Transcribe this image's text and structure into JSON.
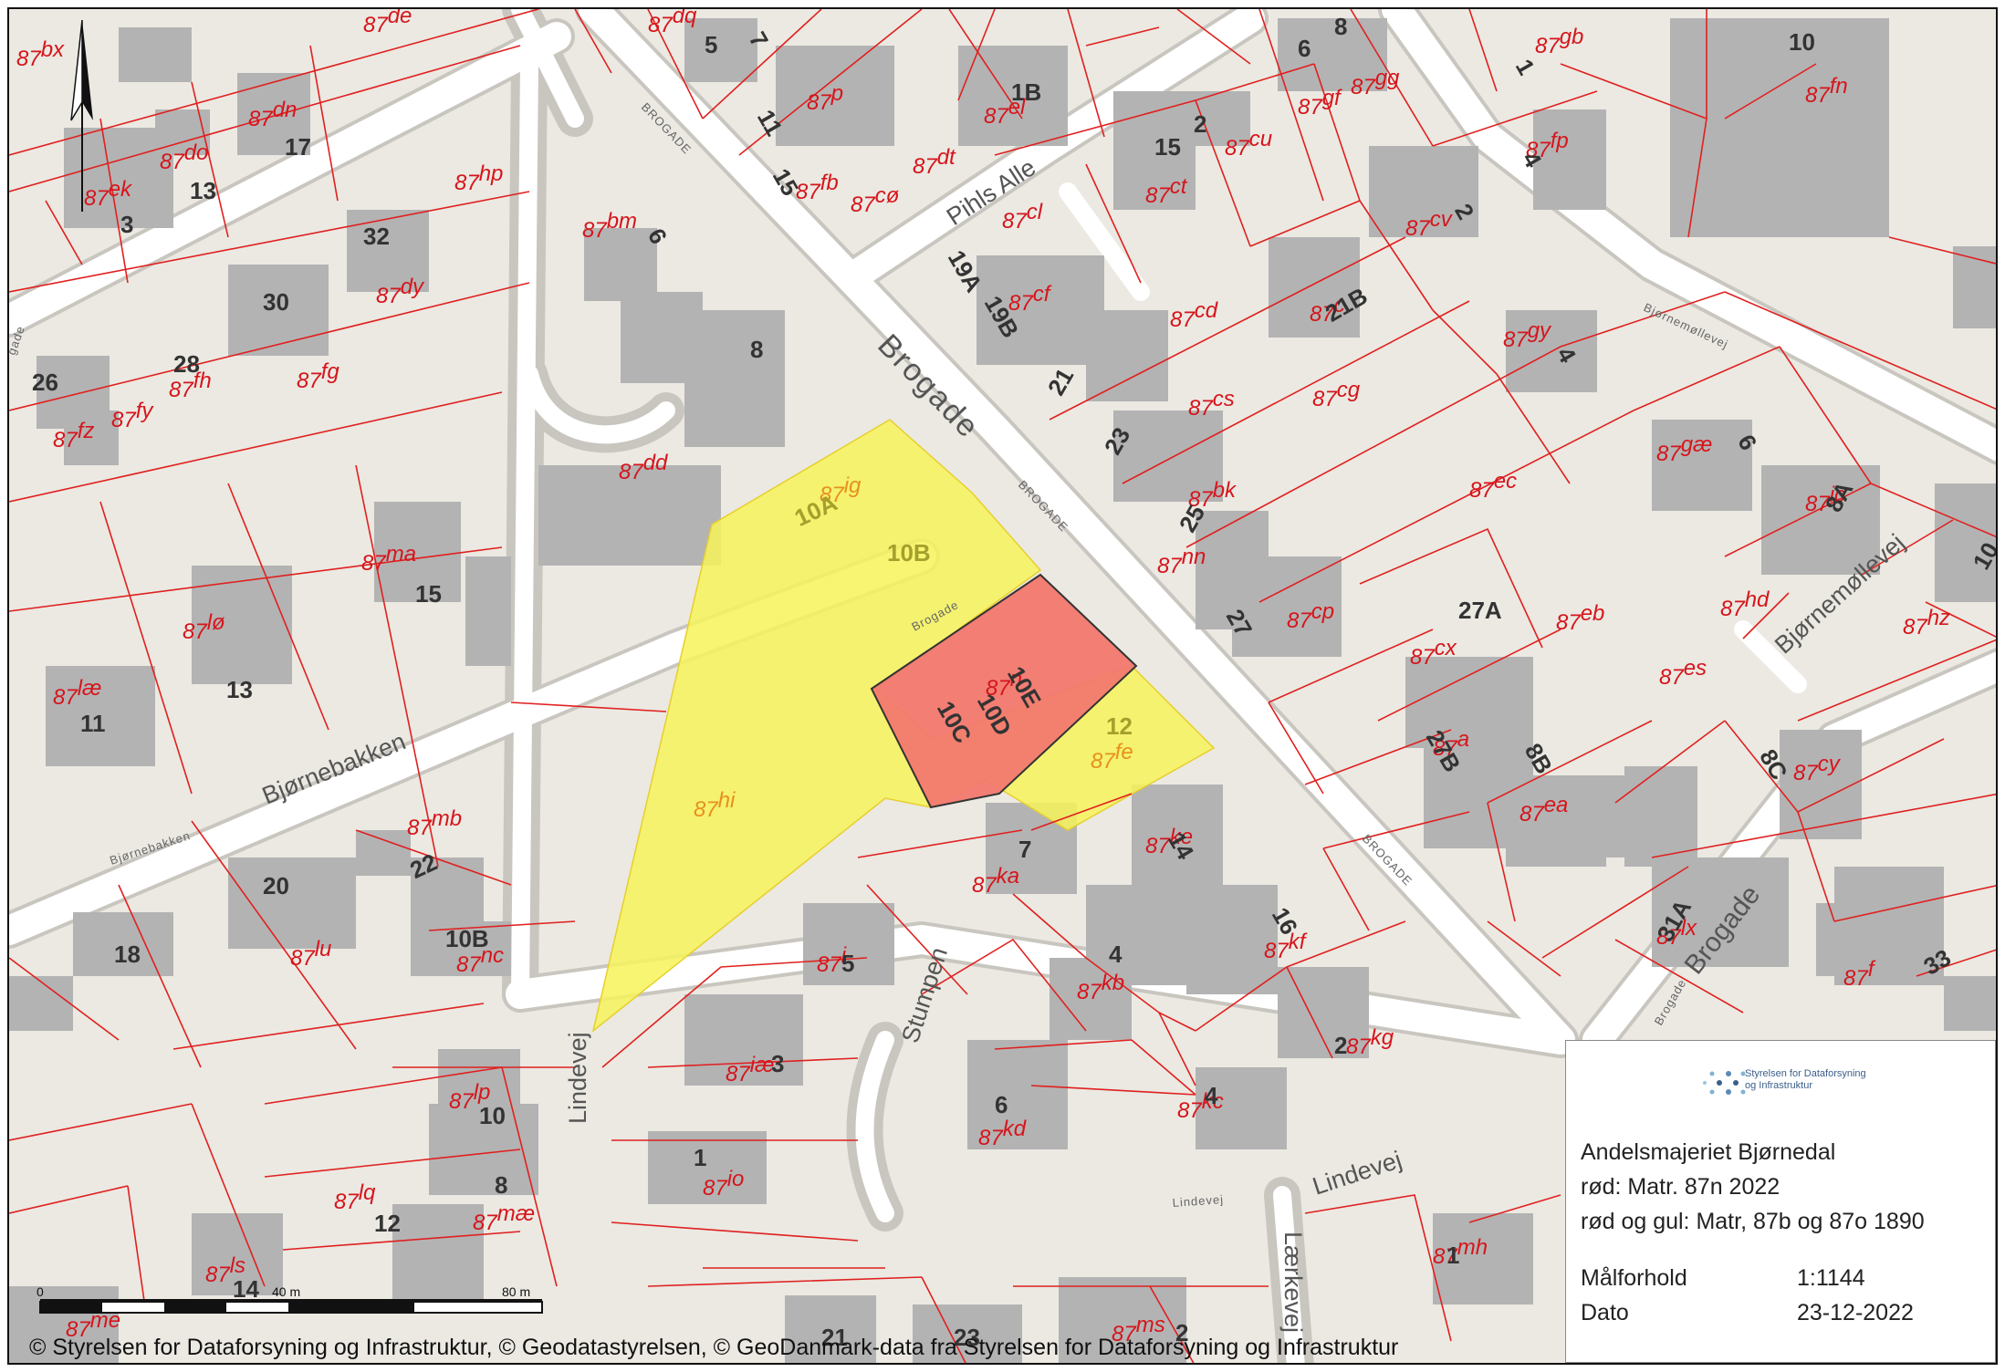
{
  "legend": {
    "agency": "Styrelsen for Dataforsyning og Infrastruktur",
    "title": "Andelsmajeriet Bjørnedal",
    "line_red": "rød: Matr. 87n 2022",
    "line_red_yellow": "rød og gul: Matr, 87b og 87o 1890",
    "scale_label": "Målforhold",
    "scale_value": "1:1144",
    "date_label": "Dato",
    "date_value": "23-12-2022"
  },
  "copyright": "© Styrelsen for Dataforsyning og Infrastruktur, © Geodatastyrelsen, © GeoDanmark-data fra Styrelsen for Dataforsyning og Infrastruktur",
  "scale_bar": {
    "labels": [
      "0",
      "40 m",
      "80 m"
    ]
  },
  "colors": {
    "highlight_red": "#f2786e",
    "highlight_yellow": "#f7f35a",
    "parcel_line": "#e0201f",
    "building": "#b3b3b3",
    "background": "#ebe9e2"
  },
  "streets": {
    "brogade_main": "Brogade",
    "brogade_lower": "Brogade",
    "pihls_alle": "Pihls Alle",
    "bjornemollevej_1": "Bjørnemøllevej",
    "bjornemollevej_2": "Bjørnemøllevej",
    "bjornebakken_1": "Bjørnebakken",
    "bjornebakken_2": "Bjørnebakken",
    "stumpen": "Stumpen",
    "lindevej_1": "Lindevej",
    "lindevej_2": "Lindevej",
    "lindevej_3": "Lindevej",
    "laerkevej": "Lærkevej",
    "brogade_small_1": "BROGADE",
    "brogade_small_2": "BROGADE",
    "brogade_small_3": "BROGADE",
    "brogade_small_4": "Brogade",
    "brogade_small_5": "Brogade",
    "lindevej_small": "Lindevej",
    "bjornemollevej_small": "Bjørnemøllevej",
    "bjornebakken_small": "Bjørnebakken",
    "road_left": "gade"
  },
  "plots": [
    {
      "num": "87",
      "sup": "bx"
    },
    {
      "num": "87",
      "sup": "de"
    },
    {
      "num": "87",
      "sup": "dq"
    },
    {
      "num": "87",
      "sup": "p"
    },
    {
      "num": "87",
      "sup": "el"
    },
    {
      "num": "87",
      "sup": "gf"
    },
    {
      "num": "87",
      "sup": "gg"
    },
    {
      "num": "87",
      "sup": "gb"
    },
    {
      "num": "87",
      "sup": "fn"
    },
    {
      "num": "87",
      "sup": "dn"
    },
    {
      "num": "87",
      "sup": "do"
    },
    {
      "num": "87",
      "sup": "ek"
    },
    {
      "num": "87",
      "sup": "hp"
    },
    {
      "num": "87",
      "sup": "bm"
    },
    {
      "num": "87",
      "sup": "fb"
    },
    {
      "num": "87",
      "sup": "cø"
    },
    {
      "num": "87",
      "sup": "dt"
    },
    {
      "num": "87",
      "sup": "cu"
    },
    {
      "num": "87",
      "sup": "ct"
    },
    {
      "num": "87",
      "sup": "fp"
    },
    {
      "num": "87",
      "sup": "cl"
    },
    {
      "num": "87",
      "sup": "cv"
    },
    {
      "num": "87",
      "sup": "dy"
    },
    {
      "num": "87",
      "sup": "cf"
    },
    {
      "num": "87",
      "sup": "cd"
    },
    {
      "num": "87",
      "sup": "c"
    },
    {
      "num": "87",
      "sup": "gy"
    },
    {
      "num": "87",
      "sup": "fh"
    },
    {
      "num": "87",
      "sup": "fg"
    },
    {
      "num": "87",
      "sup": "fy"
    },
    {
      "num": "87",
      "sup": "fz"
    },
    {
      "num": "87",
      "sup": "cs"
    },
    {
      "num": "87",
      "sup": "cg"
    },
    {
      "num": "87",
      "sup": "dd"
    },
    {
      "num": "87",
      "sup": "gæ"
    },
    {
      "num": "87",
      "sup": "ig"
    },
    {
      "num": "87",
      "sup": "bk"
    },
    {
      "num": "87",
      "sup": "ec"
    },
    {
      "num": "87",
      "sup": "ic"
    },
    {
      "num": "87",
      "sup": "ma"
    },
    {
      "num": "87",
      "sup": "nn"
    },
    {
      "num": "87",
      "sup": "lø"
    },
    {
      "num": "87",
      "sup": "cp"
    },
    {
      "num": "87",
      "sup": "hd"
    },
    {
      "num": "87",
      "sup": "eb"
    },
    {
      "num": "87",
      "sup": "hz"
    },
    {
      "num": "87",
      "sup": "læ"
    },
    {
      "num": "87",
      "sup": "cx"
    },
    {
      "num": "87",
      "sup": "es"
    },
    {
      "num": "87",
      "sup": "n"
    },
    {
      "num": "87",
      "sup": "a"
    },
    {
      "num": "87",
      "sup": "fe"
    },
    {
      "num": "87",
      "sup": "cy"
    },
    {
      "num": "87",
      "sup": "hi"
    },
    {
      "num": "87",
      "sup": "ea"
    },
    {
      "num": "87",
      "sup": "mb"
    },
    {
      "num": "87",
      "sup": "ke"
    },
    {
      "num": "87",
      "sup": "ka"
    },
    {
      "num": "87",
      "sup": "lu"
    },
    {
      "num": "87",
      "sup": "nc"
    },
    {
      "num": "87",
      "sup": "i"
    },
    {
      "num": "87",
      "sup": "kf"
    },
    {
      "num": "87",
      "sup": "lx"
    },
    {
      "num": "87",
      "sup": "f"
    },
    {
      "num": "87",
      "sup": "kb"
    },
    {
      "num": "87",
      "sup": "kg"
    },
    {
      "num": "87",
      "sup": "iæ"
    },
    {
      "num": "87",
      "sup": "lp"
    },
    {
      "num": "87",
      "sup": "kd"
    },
    {
      "num": "87",
      "sup": "kc"
    },
    {
      "num": "87",
      "sup": "io"
    },
    {
      "num": "87",
      "sup": "lq"
    },
    {
      "num": "87",
      "sup": "mæ"
    },
    {
      "num": "87",
      "sup": "mh"
    },
    {
      "num": "87",
      "sup": "ls"
    },
    {
      "num": "87",
      "sup": "me"
    },
    {
      "num": "87",
      "sup": "ms"
    }
  ],
  "houses": [
    "5",
    "7",
    "8",
    "6",
    "10",
    "1B",
    "1",
    "11",
    "15",
    "17",
    "13",
    "15",
    "2",
    "4",
    "3",
    "32",
    "6",
    "19A",
    "19B",
    "2",
    "30",
    "21B",
    "4",
    "28",
    "26",
    "21",
    "8",
    "23",
    "6",
    "10A",
    "10B",
    "25",
    "8A",
    "15",
    "27",
    "27A",
    "10",
    "13",
    "10E",
    "10D",
    "10C",
    "12",
    "11",
    "27B",
    "8B",
    "8C",
    "22",
    "7",
    "14",
    "20",
    "10B",
    "16",
    "31A",
    "18",
    "5",
    "4",
    "33",
    "2",
    "3",
    "6",
    "4",
    "10",
    "1",
    "8",
    "12",
    "1",
    "21",
    "23",
    "2",
    "14"
  ]
}
